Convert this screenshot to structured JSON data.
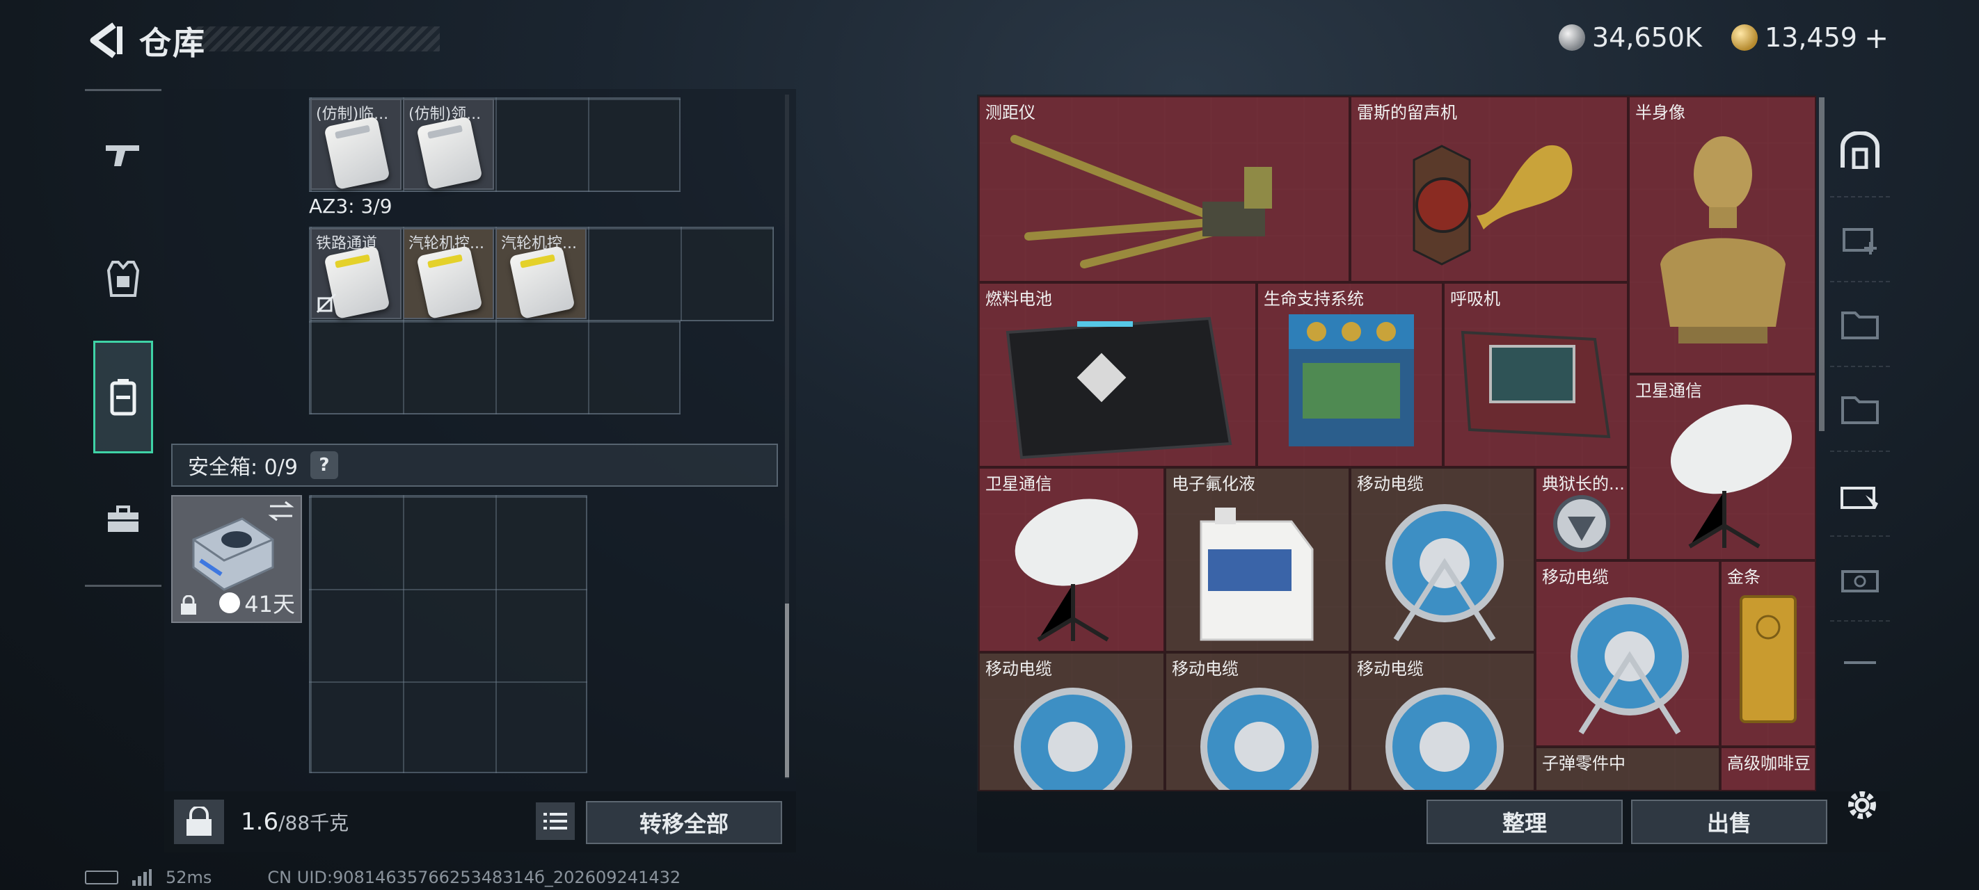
{
  "header": {
    "title": "仓库"
  },
  "currency": {
    "silver": "34,650K",
    "gold": "13,459",
    "gold_add": "+"
  },
  "left": {
    "top_items": [
      {
        "label": "(仿制)临..."
      },
      {
        "label": "(仿制)领..."
      }
    ],
    "az3_label": "AZ3: 3/9",
    "az3_items": [
      {
        "label": "铁路通道"
      },
      {
        "label": "汽轮机控..."
      },
      {
        "label": "汽轮机控..."
      }
    ],
    "safebox_label": "安全箱: 0/9",
    "safebox_help": "?",
    "safebox_days": "41天",
    "weight": "1.6",
    "weight_cap": "/88千克",
    "transfer_all": "转移全部"
  },
  "stash": {
    "items": [
      {
        "name": "测距仪"
      },
      {
        "name": "雷斯的留声机"
      },
      {
        "name": "半身像"
      },
      {
        "name": "燃料电池"
      },
      {
        "name": "生命支持系统"
      },
      {
        "name": "呼吸机"
      },
      {
        "name": "卫星通信"
      },
      {
        "name": "卫星通信"
      },
      {
        "name": "电子氟化液"
      },
      {
        "name": "移动电缆"
      },
      {
        "name": "典狱长的..."
      },
      {
        "name": "移动电缆"
      },
      {
        "name": "金条"
      },
      {
        "name": "移动电缆"
      },
      {
        "name": "移动电缆"
      },
      {
        "name": "移动电缆"
      },
      {
        "name": "子弹零件中"
      },
      {
        "name": "高级咖啡豆"
      }
    ],
    "sort_button": "整理",
    "sell_button": "出售"
  },
  "status": {
    "ping": "52ms",
    "uid": "CN UID:9081463576625348314б_202609241432"
  },
  "colors": {
    "accent": "#3fd3a6",
    "stash_bg": "#6b2f36"
  }
}
